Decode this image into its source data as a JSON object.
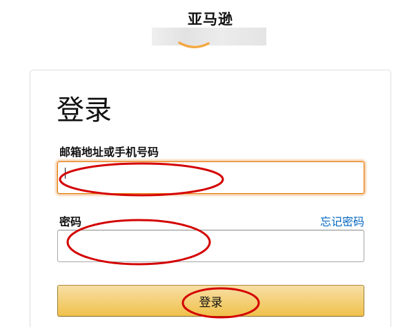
{
  "header": {
    "brand_name": "亚马逊"
  },
  "signin": {
    "heading": "登录",
    "email_label": "邮箱地址或手机号码",
    "email_value": "",
    "password_label": "密码",
    "password_value": "",
    "forgot_password_link": "忘记密码",
    "submit_label": "登录"
  },
  "colors": {
    "link": "#0066c0",
    "button_top": "#f7dfa5",
    "button_bottom": "#f0c14b",
    "focus_border": "#e77600",
    "annotation_red": "#d40000",
    "logo_orange": "#f5a742"
  },
  "icons": {
    "logo": "amazon-smile-logo"
  }
}
